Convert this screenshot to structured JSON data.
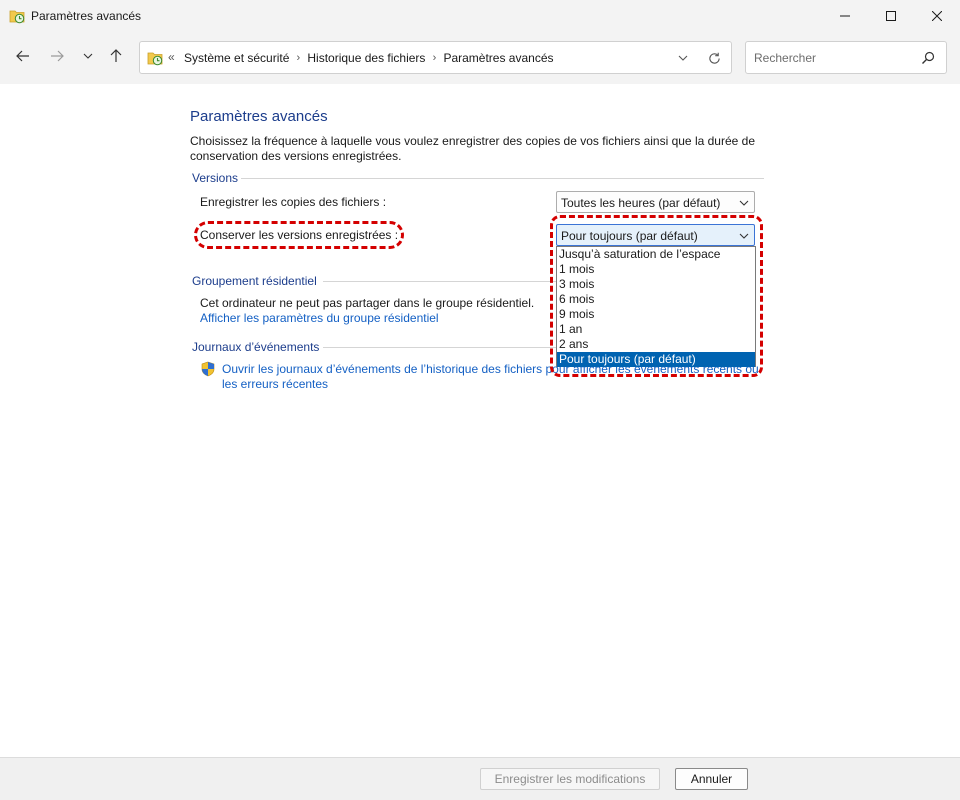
{
  "window": {
    "title": "Paramètres avancés",
    "icon": "file-history-icon"
  },
  "nav": {
    "breadcrumb_overflow": "«",
    "breadcrumbs": [
      "Système et sécurité",
      "Historique des fichiers",
      "Paramètres avancés"
    ],
    "search_placeholder": "Rechercher"
  },
  "main": {
    "title": "Paramètres avancés",
    "description": "Choisissez la fréquence à laquelle vous voulez enregistrer des copies de vos fichiers ainsi que la durée de conservation des versions enregistrées.",
    "versions": {
      "header": "Versions",
      "save_copies_label": "Enregistrer les copies des fichiers :",
      "save_copies_value": "Toutes les heures (par défaut)",
      "keep_versions_label": "Conserver les versions enregistrées :",
      "keep_versions_value": "Pour toujours (par défaut)",
      "keep_versions_options": [
        "Jusqu’à saturation de l’espace",
        "1 mois",
        "3 mois",
        "6 mois",
        "9 mois",
        "1 an",
        "2 ans",
        "Pour toujours (par défaut)"
      ],
      "selected_index": 7
    },
    "homegroup": {
      "header": "Groupement résidentiel",
      "message": "Cet ordinateur ne peut pas partager dans le groupe résidentiel.",
      "link": "Afficher les paramètres du groupe résidentiel"
    },
    "eventlogs": {
      "header": "Journaux d’événements",
      "link_line1": "Ouvrir les journaux d’événements de l’historique des fichiers pour afficher les événements récents ou",
      "link_line2": "les erreurs récentes"
    }
  },
  "footer": {
    "save_label": "Enregistrer les modifications",
    "cancel_label": "Annuler"
  },
  "colors": {
    "accent": "#1c3d8c",
    "link": "#1460c4",
    "selection": "#0063b1",
    "annotation": "#d40000"
  }
}
